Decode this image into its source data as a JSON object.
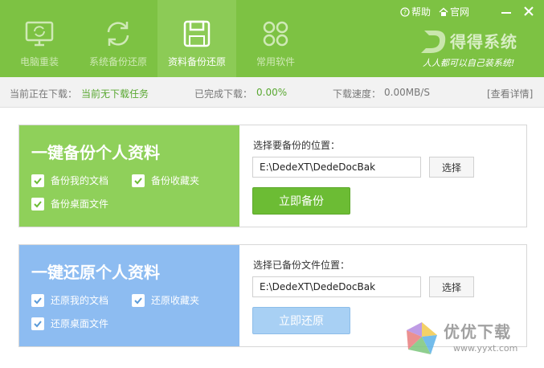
{
  "header": {
    "nav": [
      {
        "label": "电脑重装",
        "icon": "monitor-refresh-icon",
        "active": false
      },
      {
        "label": "系统备份还原",
        "icon": "sync-icon",
        "active": false
      },
      {
        "label": "资料备份还原",
        "icon": "floppy-disk-icon",
        "active": true
      },
      {
        "label": "常用软件",
        "icon": "apps-grid-icon",
        "active": false
      }
    ],
    "help_label": "帮助",
    "site_label": "官网",
    "brand_name": "得得系统",
    "brand_slogan": "人人都可以自己装系统!"
  },
  "status": {
    "downloading_label": "当前正在下载：",
    "downloading_value": "当前无下载任务",
    "completed_label": "已完成下载：",
    "completed_value": "0.00%",
    "speed_label": "下载速度：",
    "speed_value": "0.00MB/S",
    "detail_link": "[查看详情]"
  },
  "backup": {
    "title": "一键备份个人资料",
    "options": [
      {
        "label": "备份我的文档",
        "checked": true
      },
      {
        "label": "备份收藏夹",
        "checked": true
      },
      {
        "label": "备份桌面文件",
        "checked": true
      }
    ],
    "location_label": "选择要备份的位置：",
    "path_value": "E:\\DedeXT\\DedeDocBak",
    "choose_label": "选择",
    "action_label": "立即备份"
  },
  "restore": {
    "title": "一键还原个人资料",
    "options": [
      {
        "label": "还原我的文档",
        "checked": true
      },
      {
        "label": "还原收藏夹",
        "checked": true
      },
      {
        "label": "还原桌面文件",
        "checked": true
      }
    ],
    "location_label": "选择已备份文件位置：",
    "path_value": "E:\\DedeXT\\DedeDocBak",
    "choose_label": "选择",
    "action_label": "立即还原"
  },
  "watermark": {
    "text": "优优下载",
    "url": "www.yyxt.com"
  },
  "colors": {
    "header_green": "#7dc243",
    "backup_green": "#8fd05a",
    "restore_blue": "#8dbcf1",
    "action_green": "#6cbc34",
    "action_blue": "#a8d0f4"
  }
}
